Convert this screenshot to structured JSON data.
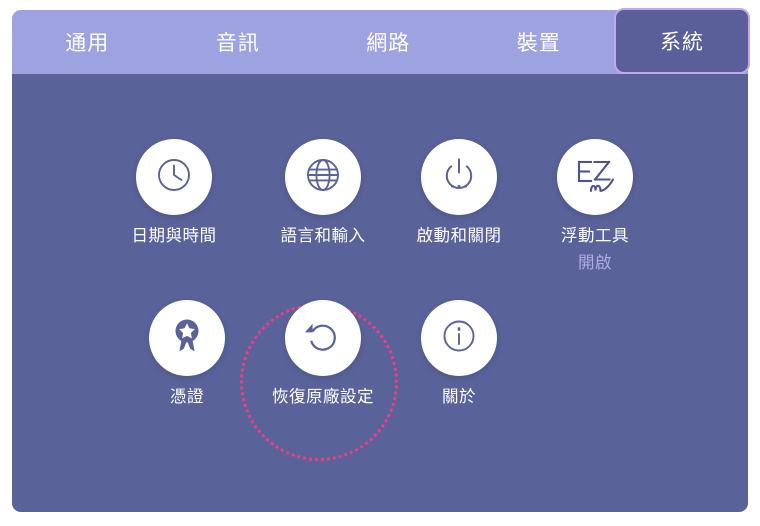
{
  "app": {
    "accent_active_tab_bg": "#5a5f99",
    "accent_active_tab_border": "#c3a8ee",
    "tabbar_bg": "#9da2e0",
    "panel_bg": "#596299",
    "highlight_color": "#ee3f80",
    "sub_label_color": "#b3a9e8",
    "tile_disc_color": "#ffffff",
    "icon_color": "#596299"
  },
  "tabs": [
    {
      "id": "general",
      "label": "通用",
      "active": false
    },
    {
      "id": "audio",
      "label": "音訊",
      "active": false
    },
    {
      "id": "network",
      "label": "網路",
      "active": false
    },
    {
      "id": "device",
      "label": "裝置",
      "active": false
    },
    {
      "id": "system",
      "label": "系統",
      "active": true
    }
  ],
  "tiles": [
    {
      "id": "date-time",
      "icon": "clock-icon",
      "label": "日期與時間",
      "sub": ""
    },
    {
      "id": "language-input",
      "icon": "globe-icon",
      "label": "語言和輸入",
      "sub": ""
    },
    {
      "id": "power",
      "icon": "power-icon",
      "label": "啟動和關閉",
      "sub": ""
    },
    {
      "id": "floating-tool",
      "icon": "ezm-logo-icon",
      "label": "浮動工具",
      "sub": "開啟"
    },
    {
      "id": "certificate",
      "icon": "award-icon",
      "label": "憑證",
      "sub": ""
    },
    {
      "id": "factory-reset",
      "icon": "reset-icon",
      "label": "恢復原廠設定",
      "sub": ""
    },
    {
      "id": "about",
      "icon": "info-icon",
      "label": "關於",
      "sub": ""
    }
  ]
}
